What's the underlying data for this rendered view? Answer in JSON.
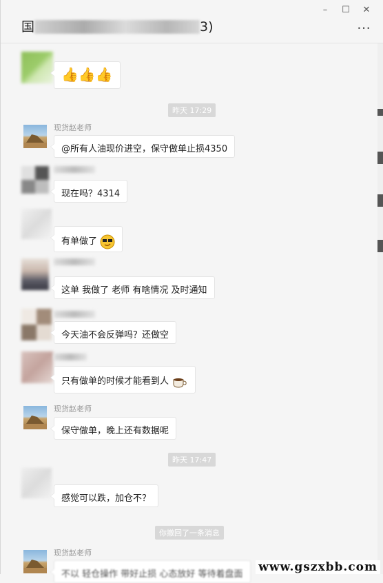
{
  "window": {
    "title_visible_left": "国",
    "title_visible_right": "3)",
    "minimize": "–",
    "maximize": "☐",
    "close": "✕",
    "more": "⋯"
  },
  "messages": [
    {
      "sender": "",
      "text": "👍👍👍"
    },
    {
      "time": "昨天 17:29"
    },
    {
      "sender": "现货赵老师",
      "text": "@所有人油现价进空，保守做单止损4350"
    },
    {
      "sender": "",
      "text": "现在吗？4314"
    },
    {
      "sender": "",
      "text": "有单做了"
    },
    {
      "sender": "",
      "text": "这单 我做了 老师 有啥情况 及时通知"
    },
    {
      "sender": "",
      "text": "今天油不会反弹吗？还做空"
    },
    {
      "sender": "",
      "text": "只有做单的时候才能看到人"
    },
    {
      "sender": "现货赵老师",
      "text": "保守做单，晚上还有数据呢"
    },
    {
      "time": "昨天 17:47"
    },
    {
      "sender": "",
      "text": "感觉可以跌，加仓不？"
    },
    {
      "notice": "你撤回了一条消息"
    },
    {
      "sender": "现货赵老师",
      "text": "不以 轻仓操作 带好止损 心态放好 等待着盘面"
    }
  ],
  "watermark": "www.gszxbb.com",
  "colors": {
    "bg": "#f5f5f5",
    "bubble": "#ffffff",
    "time_chip": "#d8d8d8"
  }
}
